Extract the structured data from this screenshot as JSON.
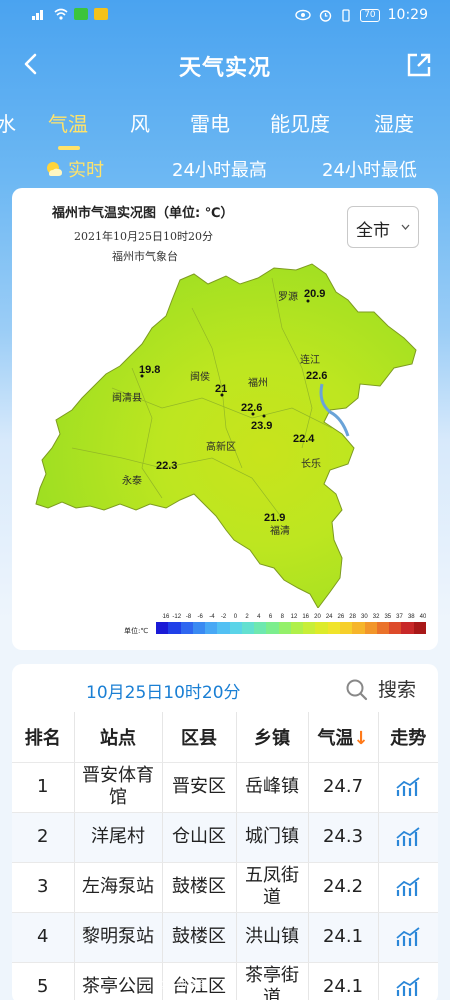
{
  "status_bar": {
    "time": "10:29",
    "battery": "70",
    "left_icons": [
      "signal-icon",
      "wifi-icon",
      "wechat-icon",
      "message-icon"
    ],
    "right_icons": [
      "eye-icon",
      "alarm-icon",
      "vibrate-icon"
    ]
  },
  "header": {
    "title": "天气实况"
  },
  "tabs": [
    "水",
    "气温",
    "风",
    "雷电",
    "能见度",
    "湿度"
  ],
  "active_tab": "气温",
  "subtabs": {
    "realtime": "实时",
    "max24": "24小时最高",
    "min24": "24小时最低"
  },
  "map": {
    "title": "福州市气温实况图（单位: ℃）",
    "time": "2021年10月25日10时20分",
    "source": "福州市气象台",
    "city_select": "全市",
    "stations": [
      {
        "name": "罗源",
        "value": "20.9"
      },
      {
        "name": "连江",
        "value": "22.6"
      },
      {
        "name": "闽清",
        "value": "19.8"
      },
      {
        "name": "闽侯",
        "value": "21"
      },
      {
        "name": "福州",
        "value": "22.6"
      },
      {
        "name": "",
        "value": "23.9"
      },
      {
        "name": "长乐",
        "value": "22.4"
      },
      {
        "name": "高新区",
        "value": ""
      },
      {
        "name": "永泰",
        "value": "22.3"
      },
      {
        "name": "福清",
        "value": "21.9"
      },
      {
        "name": "闽清县",
        "value": ""
      }
    ],
    "legend": {
      "unit": "单位:℃",
      "ticks": [
        "-16",
        "-12",
        "-8",
        "-6",
        "-4",
        "-2",
        "0",
        "2",
        "4",
        "6",
        "8",
        "12",
        "16",
        "20",
        "24",
        "26",
        "28",
        "30",
        "32",
        "35",
        "37",
        "38",
        "40"
      ],
      "colors": [
        "#1a1ad6",
        "#2040e8",
        "#2f67f0",
        "#3a8af2",
        "#48a8f5",
        "#52c0f3",
        "#5bd4e8",
        "#63e0d0",
        "#6ee8b0",
        "#7cee8e",
        "#94f06a",
        "#b0f04a",
        "#c8ee38",
        "#ddeb2a",
        "#f0e42a",
        "#f6cf2a",
        "#f6b52a",
        "#f2962a",
        "#ea722a",
        "#dd4a2a",
        "#c82828",
        "#a81818"
      ]
    }
  },
  "table": {
    "date_label": "10月25日10时20分",
    "search_label": "搜索",
    "headers": [
      "排名",
      "站点",
      "区县",
      "乡镇",
      "气温",
      "走势"
    ],
    "sort_arrow": "↓",
    "rows": [
      {
        "rank": "1",
        "station": "晋安体育馆",
        "district": "晋安区",
        "town": "岳峰镇",
        "temp": "24.7"
      },
      {
        "rank": "2",
        "station": "洋尾村",
        "district": "仓山区",
        "town": "城门镇",
        "temp": "24.3"
      },
      {
        "rank": "3",
        "station": "左海泵站",
        "district": "鼓楼区",
        "town": "五凤街道",
        "temp": "24.2"
      },
      {
        "rank": "4",
        "station": "黎明泵站",
        "district": "鼓楼区",
        "town": "洪山镇",
        "temp": "24.1"
      },
      {
        "rank": "5",
        "station": "茶亭公园",
        "district": "台江区",
        "town": "茶亭街道",
        "temp": "24.1"
      }
    ]
  },
  "watermark": "@福州气象",
  "colors": {
    "accent_yellow": "#ffe36a",
    "date_blue": "#1a7fd4",
    "sort_orange": "#ff7a1a",
    "map_fill": "#b9e81e"
  }
}
